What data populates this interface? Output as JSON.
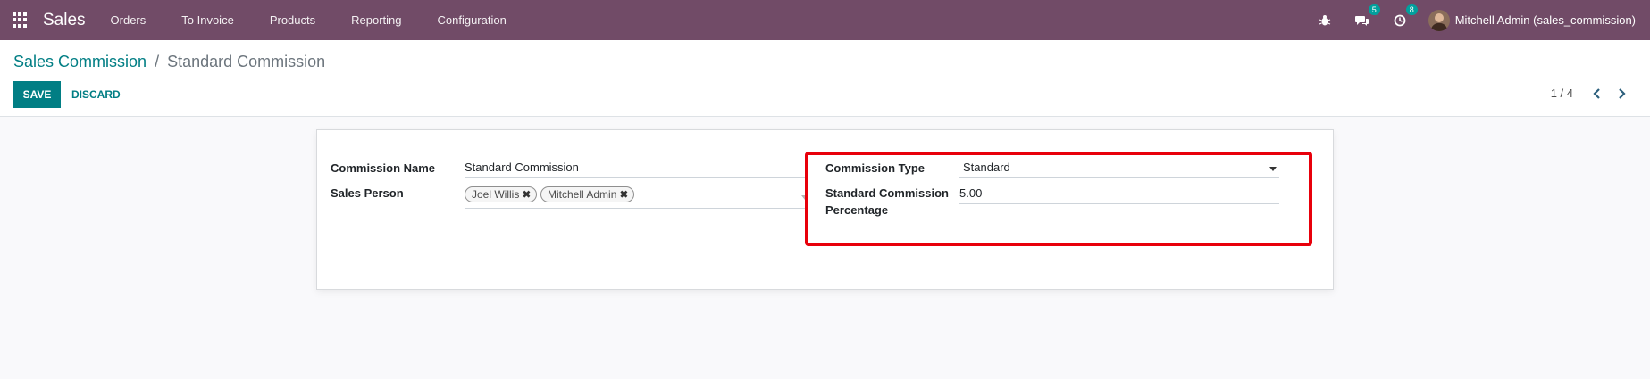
{
  "navbar": {
    "app_title": "Sales",
    "menu": [
      "Orders",
      "To Invoice",
      "Products",
      "Reporting",
      "Configuration"
    ],
    "messages_count": "5",
    "activities_count": "8",
    "user_name": "Mitchell Admin (sales_commission)"
  },
  "breadcrumb": {
    "parent": "Sales Commission",
    "separator": "/",
    "current": "Standard Commission"
  },
  "actions": {
    "save_label": "SAVE",
    "discard_label": "DISCARD"
  },
  "pager": {
    "text": "1 / 4"
  },
  "form": {
    "commission_name_label": "Commission Name",
    "commission_name_value": "Standard Commission",
    "sales_person_label": "Sales Person",
    "sales_person_tags": [
      "Joel Willis",
      "Mitchell Admin"
    ],
    "commission_type_label": "Commission Type",
    "commission_type_value": "Standard",
    "std_percentage_label_line1": "Standard Commission",
    "std_percentage_label_line2": "Percentage",
    "std_percentage_value": "5.00"
  },
  "colors": {
    "navbar": "#714b67",
    "primary": "#017e84",
    "badge": "#00a09d",
    "highlight": "#e8000b"
  }
}
